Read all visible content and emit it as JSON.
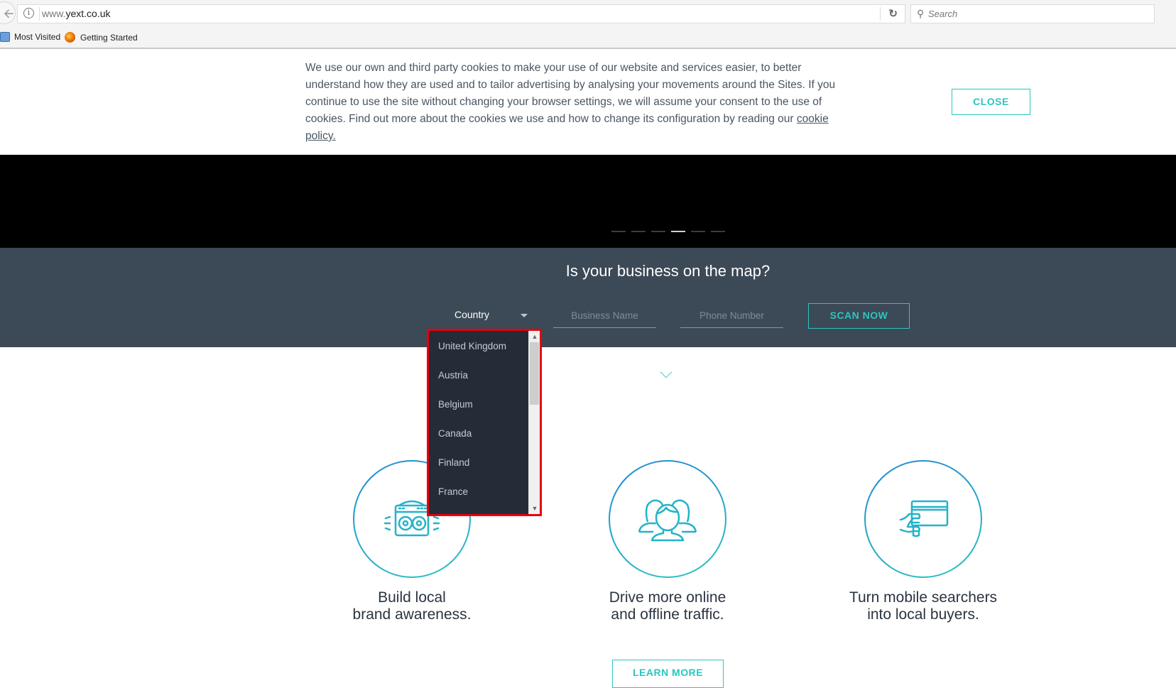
{
  "browser": {
    "url_prefix": "www.",
    "url_domain": "yext.co.uk",
    "search_placeholder": "Search",
    "bookmarks": [
      {
        "label": "Most Visited",
        "icon": "most-visited-icon"
      },
      {
        "label": "Getting Started",
        "icon": "firefox-icon"
      }
    ]
  },
  "cookie_banner": {
    "text": "We use our own and third party cookies to make your use of our website and services easier, to better understand how they are used and to tailor advertising by analysing your movements around the Sites. If you continue to use the site without changing your browser settings, we will assume your consent to the use of cookies. Find out more about the cookies we use and how to change its configuration by reading our ",
    "link_text": "cookie policy.",
    "close_label": "CLOSE"
  },
  "hero": {
    "slide_count": 6,
    "active_slide": 4
  },
  "scan": {
    "title": "Is your business on the map?",
    "country_label": "Country",
    "business_placeholder": "Business Name",
    "phone_placeholder": "Phone Number",
    "scan_label": "SCAN NOW"
  },
  "country_dropdown": {
    "options": [
      "United Kingdom",
      "Austria",
      "Belgium",
      "Canada",
      "Finland",
      "France"
    ]
  },
  "features": [
    {
      "line1": "Build local",
      "line2": "brand awareness.",
      "icon": "radio-icon"
    },
    {
      "line1": "Drive more online",
      "line2": "and offline traffic.",
      "icon": "people-icon"
    },
    {
      "line1": "Turn mobile searchers",
      "line2": "into local buyers.",
      "icon": "card-payment-icon"
    }
  ],
  "learn_more_label": "LEARN MORE",
  "colors": {
    "accent": "#2ac6c0",
    "scan_bg": "#3c4957",
    "dropdown_bg": "#242c38",
    "highlight": "#e8000b"
  }
}
